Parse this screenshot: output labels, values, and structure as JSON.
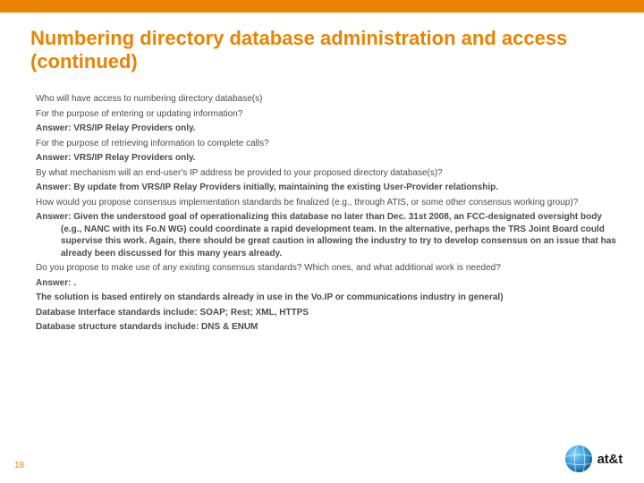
{
  "title": "Numbering directory database administration and access (continued)",
  "lines": {
    "l0": "Who will have access to numbering directory database(s)",
    "l1": "For the purpose of entering or updating information?",
    "l2": "Answer: VRS/IP Relay Providers only.",
    "l3": "For the purpose of retrieving information to complete calls?",
    "l4": "Answer: VRS/IP Relay Providers only.",
    "l5": "By what mechanism will an end-user's IP address be provided to your proposed directory database(s)?",
    "l6": "Answer: By update from VRS/IP Relay Providers initially, maintaining the existing User-Provider relationship.",
    "l7": "How would you propose consensus implementation standards be finalized (e.g., through ATIS, or some other consensus working group)?",
    "l8": "Answer: Given the understood goal of operationalizing this database no later than Dec. 31st 2008, an FCC-designated oversight body (e.g., NANC with its Fo.N WG) could coordinate a rapid development team.  In the alternative, perhaps the TRS Joint Board could supervise this work.   Again, there should be great caution in allowing the industry to try to develop consensus on an issue that has already been discussed for this many years already.",
    "l9": "Do you propose to make use of any existing consensus standards? Which ones, and what additional work is needed?",
    "l10": "Answer: .",
    "l11": "The solution is based entirely on standards already in use in the Vo.IP or communications industry in general)",
    "l12": "Database Interface standards include: SOAP; Rest; XML, HTTPS",
    "l13": "Database structure standards include: DNS & ENUM"
  },
  "page_number": "18",
  "logo_text": "at&t"
}
